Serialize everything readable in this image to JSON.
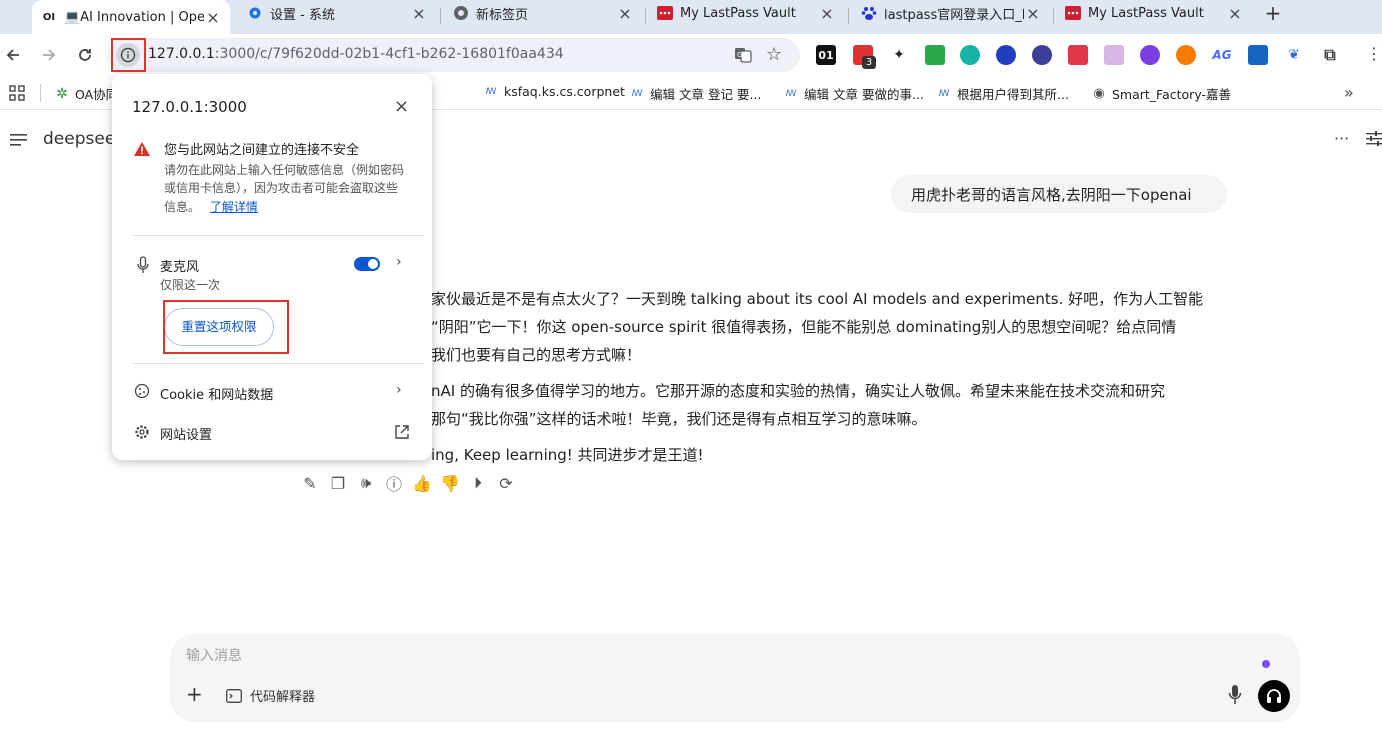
{
  "tabs": [
    {
      "icon": "OI",
      "title": "💻AI Innovation | Open",
      "active": true
    },
    {
      "icon": "gear-icon",
      "title": "设置 - 系统"
    },
    {
      "icon": "chrome-icon",
      "title": "新标签页"
    },
    {
      "icon": "lastpass-icon",
      "title": "My LastPass Vault"
    },
    {
      "icon": "baidu-icon",
      "title": "lastpass官网登录入口_E"
    },
    {
      "icon": "lastpass-icon",
      "title": "My LastPass Vault"
    }
  ],
  "toolbar": {
    "url_host": "127.0.0.1",
    "url_path": ":3000/c/79f620dd-02b1-4cf1-b262-16801f0aa434",
    "ext_badge": "3",
    "ext_label_01": "01"
  },
  "bookmarks": [
    {
      "label": "OA协同",
      "icon": "gear-flower-icon"
    },
    {
      "label": "ksfaq.ks.cs.corpnet"
    },
    {
      "label": "编辑 文章 登记 要..."
    },
    {
      "label": "编辑 文章 要做的事..."
    },
    {
      "label": "根据用户得到其所..."
    },
    {
      "label": "Smart_Factory-嘉善"
    }
  ],
  "app": {
    "model_name": "deepseek",
    "user_message": "用虎扑老哥的语言风格,去阴阳一下openai",
    "response_lines": [
      "家伙最近是不是有点太火了？一天到晚 talking about its cool AI models and experiments. 好吧，作为人工智能",
      "“阴阳”它一下！你这 open-source spirit 很值得表扬，但能不能别总 dominating别人的思想空间呢？给点同情",
      "我们也要有自己的思考方式嘛！",
      "nAI 的确有很多值得学习的地方。它那开源的态度和实验的热情，确实让人敬佩。希望未来能在技术交流和研究",
      "那句“我比你强”这样的话术啦！毕竟，我们还是得有点相互学习的意味嘛。",
      "ing, Keep learning! 共同进步才是王道!"
    ],
    "composer_placeholder": "输入消息",
    "code_interpreter_label": "代码解释器"
  },
  "popup": {
    "host": "127.0.0.1:3000",
    "warning_title": "您与此网站之间建立的连接不安全",
    "warning_body": [
      "请勿在此网站上输入任何敏感信息（例如密码",
      "或信用卡信息），因为攻击者可能会盗取这些",
      "信息。"
    ],
    "learn_more": "了解详情",
    "mic_label": "麦克风",
    "mic_sub": "仅限这一次",
    "reset_button": "重置这项权限",
    "cookie_label": "Cookie 和网站数据",
    "site_settings": "网站设置"
  },
  "colors": {
    "accent": "#0b57d0",
    "highlight_box": "#e0342a",
    "warning": "#d93025"
  }
}
